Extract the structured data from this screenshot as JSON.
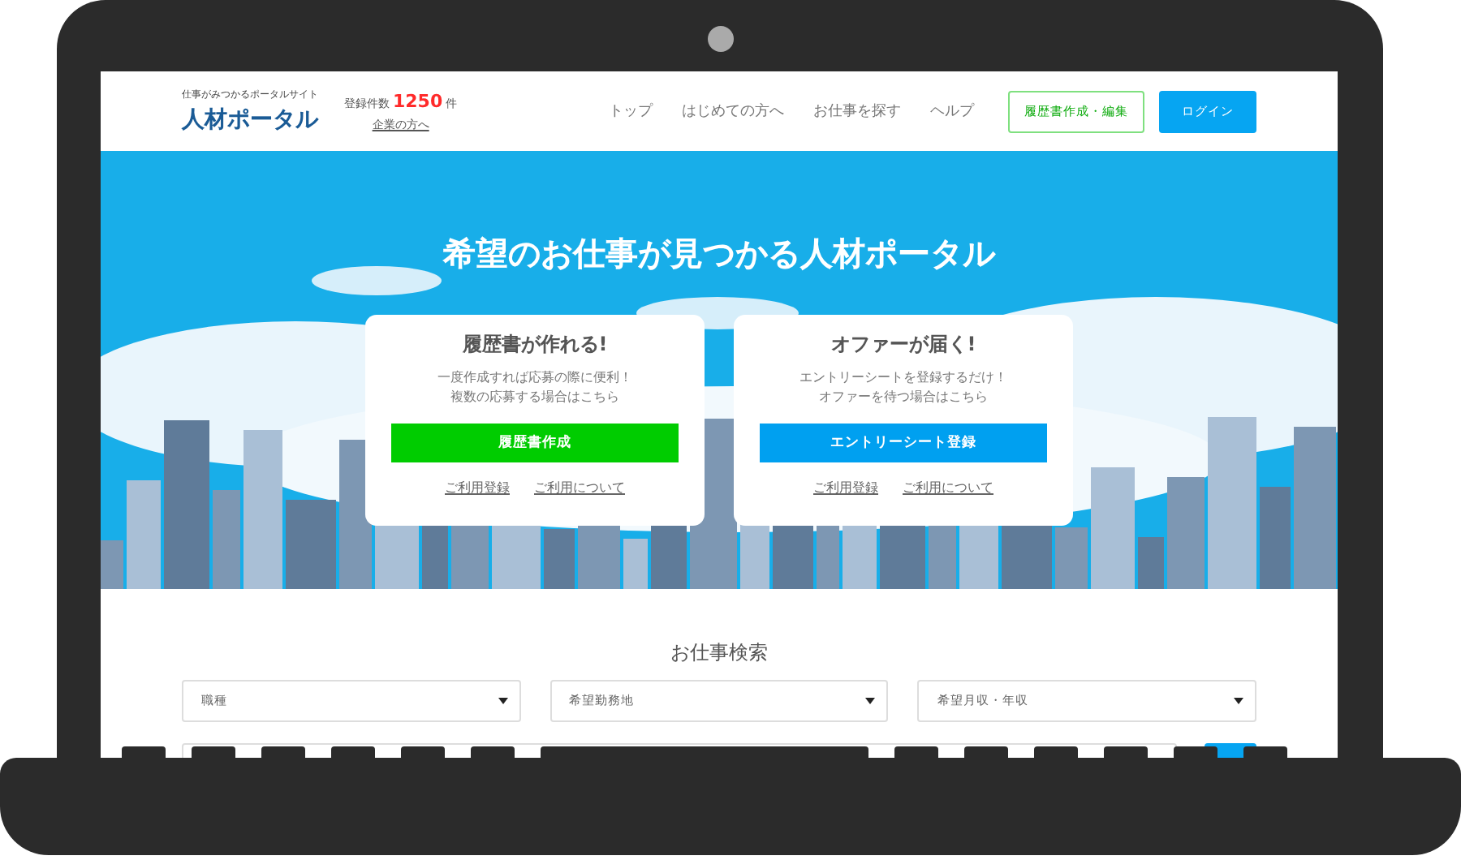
{
  "header": {
    "tagline": "仕事がみつかるポータルサイト",
    "logo": "人材ポータル",
    "count_label": "登録件数",
    "count": "1250",
    "count_unit": "件",
    "company_link": "企業の方へ",
    "nav": [
      "トップ",
      "はじめての方へ",
      "お仕事を探す",
      "ヘルプ"
    ],
    "buttons": [
      {
        "label": "履歴書作成・編集",
        "kind": "outline"
      },
      {
        "label": "ログイン",
        "kind": "solid"
      }
    ]
  },
  "hero": {
    "title": "希望のお仕事が見つかる人材ポータル",
    "cards": [
      {
        "title": "履歴書が作れる!",
        "lines": [
          "一度作成すれば応募の際に便利！",
          "複数の応募する場合はこちら"
        ],
        "button": "履歴書作成",
        "color": "#00cc00",
        "links": [
          "ご利用登録",
          "ご利用について"
        ]
      },
      {
        "title": "オファーが届く!",
        "lines": [
          "エントリーシートを登録するだけ！",
          "オファーを待つ場合はこちら"
        ],
        "button": "エントリーシート登録",
        "color": "#00a0f0",
        "links": [
          "ご利用登録",
          "ご利用について"
        ]
      }
    ]
  },
  "search": {
    "title": "お仕事検索",
    "selects": [
      "職種",
      "希望勤務地",
      "希望月収・年収"
    ]
  }
}
